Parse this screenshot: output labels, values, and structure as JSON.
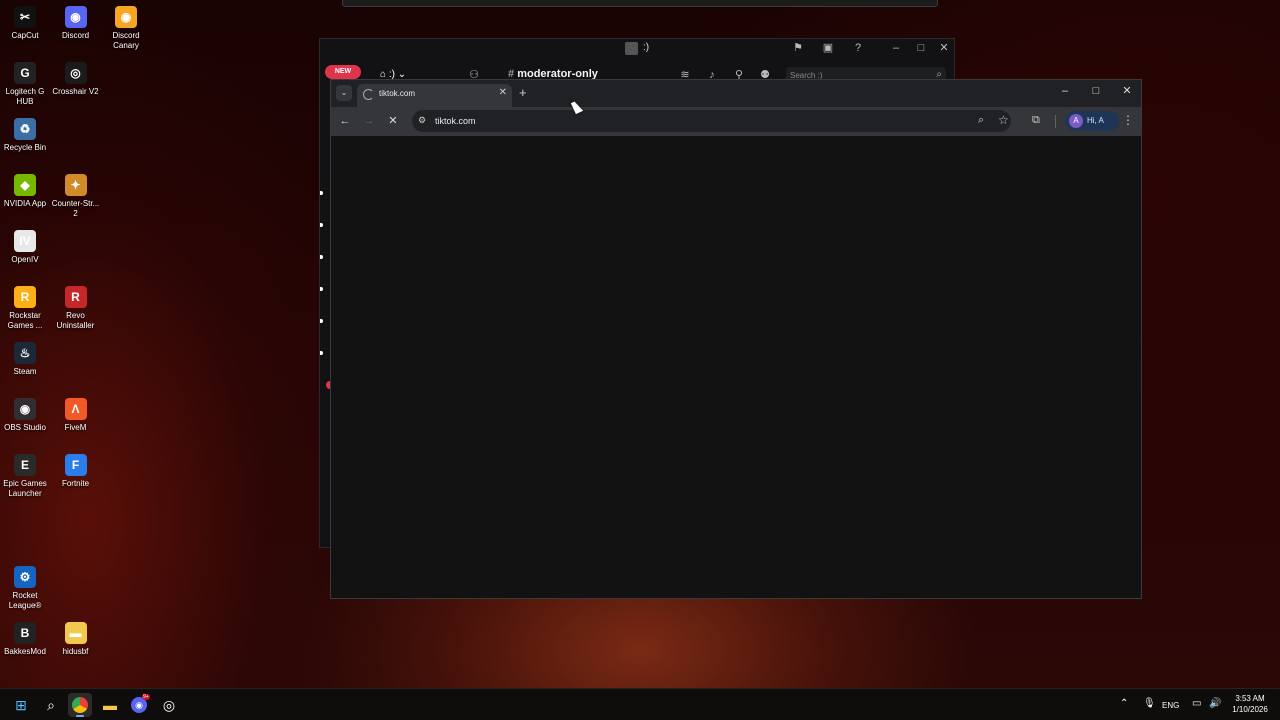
{
  "desktop": {
    "icons": [
      {
        "label": "CapCut",
        "color": "#111111",
        "glyph": "✂"
      },
      {
        "label": "Discord",
        "color": "#5865f2",
        "glyph": "◉"
      },
      {
        "label": "Discord Canary",
        "color": "#f5a623",
        "glyph": "◉"
      },
      {
        "label": "Logitech G HUB",
        "color": "#222222",
        "glyph": "G"
      },
      {
        "label": "Crosshair V2",
        "color": "#1b1b1b",
        "glyph": "◎"
      },
      {
        "label": "Recycle Bin",
        "color": "#3a6ea5",
        "glyph": "♻"
      },
      {
        "label": "NVIDIA App",
        "color": "#76b900",
        "glyph": "◆"
      },
      {
        "label": "Counter-Str... 2",
        "color": "#d18b2a",
        "glyph": "✦"
      },
      {
        "label": "OpenIV",
        "color": "#e8e8e8",
        "glyph": "IV"
      },
      {
        "label": "Rockstar Games ...",
        "color": "#fcaf17",
        "glyph": "R"
      },
      {
        "label": "Revo Uninstaller",
        "color": "#c62828",
        "glyph": "R"
      },
      {
        "label": "Steam",
        "color": "#1b2838",
        "glyph": "♨"
      },
      {
        "label": "OBS Studio",
        "color": "#302e31",
        "glyph": "◉"
      },
      {
        "label": "FiveM",
        "color": "#f15a24",
        "glyph": "Λ"
      },
      {
        "label": "Epic Games Launcher",
        "color": "#2a2a2a",
        "glyph": "E"
      },
      {
        "label": "Fortnite",
        "color": "#2b7de9",
        "glyph": "F"
      },
      {
        "label": "Rocket League®",
        "color": "#1565c0",
        "glyph": "⚙"
      },
      {
        "label": "BakkesMod",
        "color": "#222222",
        "glyph": "B"
      },
      {
        "label": "hidusbf",
        "color": "#f2c94c",
        "glyph": "▬"
      }
    ]
  },
  "discord": {
    "window_title": ":)",
    "new_badge": "NEW",
    "server_name": ":)",
    "channel": "moderator-only",
    "search_placeholder": "Search :)"
  },
  "chrome": {
    "tab_title": "tiktok.com",
    "url": "tiktok.com",
    "profile_initial": "A",
    "profile_name": "Hi, A"
  },
  "taskbar": {
    "language": "ENG",
    "time": "3:53 AM",
    "date": "1/10/2026",
    "discord_badge": "9+"
  }
}
